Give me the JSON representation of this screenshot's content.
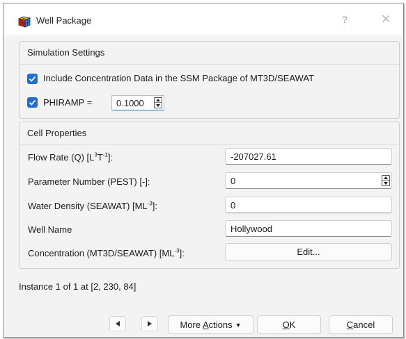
{
  "window": {
    "title": "Well Package",
    "help_glyph": "?",
    "close_glyph": "✕",
    "icon": "app-cube-icon"
  },
  "simulation_settings": {
    "title": "Simulation Settings",
    "include_concentration": {
      "label": "Include Concentration Data in the SSM Package of MT3D/SEAWAT",
      "checked": true
    },
    "phiramp": {
      "label": "PHIRAMP =",
      "checked": true,
      "value": "0.1000"
    }
  },
  "cell_properties": {
    "title": "Cell Properties",
    "rows": [
      {
        "label_prefix": "Flow Rate (Q) [L",
        "sup1": "3",
        "mid": "T",
        "sup2": "-1",
        "label_suffix": "]:",
        "value": "-207027.61"
      },
      {
        "label": "Parameter Number (PEST) [-]:",
        "value": "0"
      },
      {
        "label_prefix": "Water Density (SEAWAT) [ML",
        "sup1": "-3",
        "label_suffix": "]:",
        "value": "0"
      },
      {
        "label": "Well Name",
        "value": "Hollywood"
      },
      {
        "label_prefix": "Concentration (MT3D/SEAWAT) [ML",
        "sup1": "-3",
        "label_suffix": "]:",
        "button": "Edit..."
      }
    ]
  },
  "instance_text": "Instance 1 of 1 at [2, 230, 84]",
  "footer": {
    "prev_icon": "triangle-left-icon",
    "next_icon": "triangle-right-icon",
    "more_actions_prefix": "More ",
    "more_actions_u": "A",
    "more_actions_suffix": "ctions",
    "ok_u": "O",
    "ok_rest": "K",
    "cancel_u": "C",
    "cancel_rest": "ancel"
  },
  "colors": {
    "accent": "#1f6fd1",
    "dialog_bg": "#f3f3f3"
  }
}
